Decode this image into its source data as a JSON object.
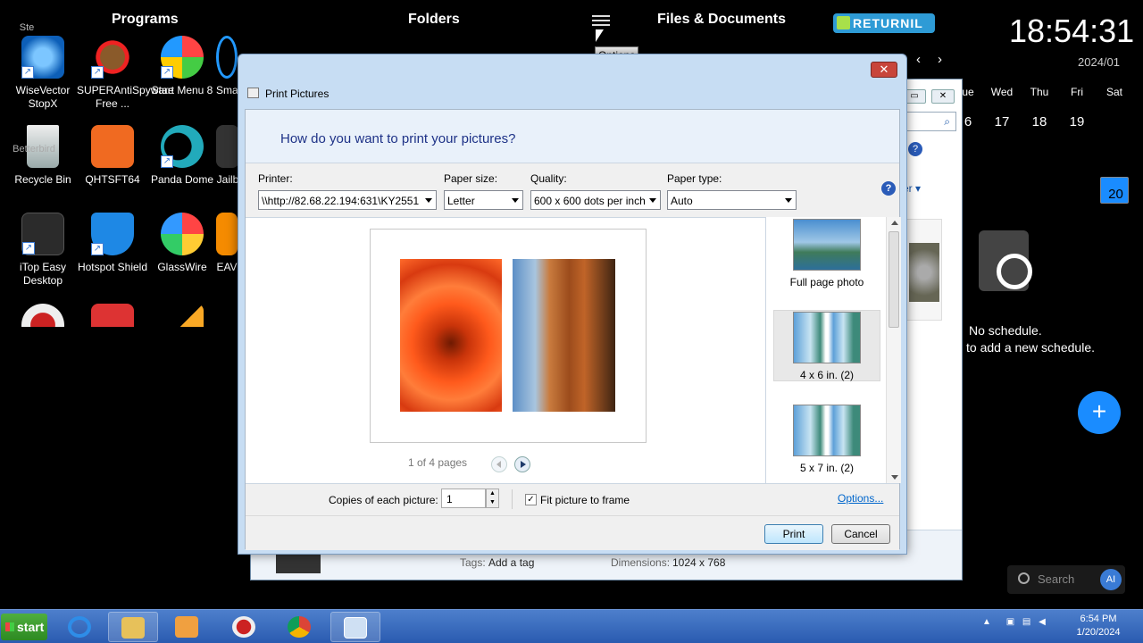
{
  "topbar": {
    "programs": "Programs",
    "folders": "Folders",
    "files": "Files & Documents",
    "options_tooltip": "Options",
    "returnil": "RETURNIL"
  },
  "clock": {
    "time": "18:54:31",
    "month": "2024/01"
  },
  "calendar": {
    "days": [
      {
        "name": "ue",
        "date": "6"
      },
      {
        "name": "Wed",
        "date": "17"
      },
      {
        "name": "Thu",
        "date": "18"
      },
      {
        "name": "Fri",
        "date": "19"
      },
      {
        "name": "Sat",
        "date": "20"
      }
    ],
    "selected": "20"
  },
  "schedule": {
    "line1": "No schedule.",
    "line2": "to add a new schedule.",
    "add": "+"
  },
  "search": {
    "placeholder": "Search",
    "ai": "AI"
  },
  "desktop_icons": [
    {
      "label": "WiseVector StopX",
      "extra": "Ste"
    },
    {
      "label": "SUPERAntiSpyware Free ..."
    },
    {
      "label": "Start Menu 8"
    },
    {
      "label": "Sma"
    },
    {
      "label": "Recycle Bin",
      "extra": "Betterbird"
    },
    {
      "label": "QHTSFT64"
    },
    {
      "label": "Panda Dome"
    },
    {
      "label": "Jailb"
    },
    {
      "label": "iTop Easy Desktop"
    },
    {
      "label": "Hotspot Shield"
    },
    {
      "label": "GlassWire"
    },
    {
      "label": "EAV"
    }
  ],
  "bg_window": {
    "tags_label": "Tags:",
    "tags_value": "Add a tag",
    "dim_label": "Dimensions:",
    "dim_value": "1024 x 768",
    "partial": "er"
  },
  "dialog": {
    "title": "Print Pictures",
    "close": "✕",
    "heading": "How do you want to print your pictures?",
    "printer_label": "Printer:",
    "printer_value": "\\\\http://82.68.22.194:631\\KY2551",
    "paper_size_label": "Paper size:",
    "paper_size_value": "Letter",
    "quality_label": "Quality:",
    "quality_value": "600 x 600  dots per inch",
    "paper_type_label": "Paper type:",
    "paper_type_value": "Auto",
    "help": "?",
    "pager": "1 of 4 pages",
    "layouts": [
      {
        "label": "Full page photo"
      },
      {
        "label": "4 x 6 in. (2)"
      },
      {
        "label": "5 x 7 in. (2)"
      }
    ],
    "copies_label": "Copies of each picture:",
    "copies_value": "1",
    "fit_label": "Fit picture to frame",
    "fit_checked": true,
    "options_link": "Options...",
    "print_button": "Print",
    "cancel_button": "Cancel"
  },
  "taskbar": {
    "start": "start",
    "time": "6:54 PM",
    "date": "1/20/2024"
  }
}
